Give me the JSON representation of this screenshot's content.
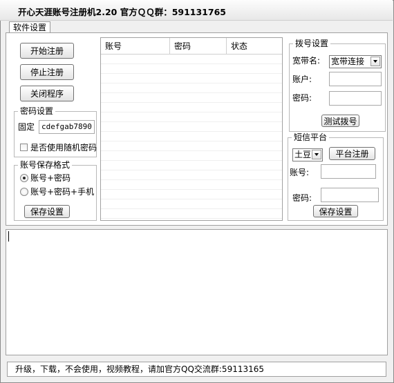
{
  "window": {
    "title": "开心天涯账号注册机2.20    官方ＱＱ群：591131765"
  },
  "tabs": [
    {
      "label": "软件设置"
    }
  ],
  "controls": {
    "start_label": "开始注册",
    "stop_label": "停止注册",
    "close_label": "关闭程序"
  },
  "password_settings": {
    "legend": "密码设置",
    "fixed_label": "固定",
    "fixed_value": "cdefgab7890",
    "random_label": "是否使用随机密码",
    "random_checked": false
  },
  "save_format": {
    "legend": "账号保存格式",
    "options": [
      {
        "label": "账号+密码",
        "checked": true
      },
      {
        "label": "账号+密码+手机",
        "checked": false
      }
    ],
    "save_label": "保存设置"
  },
  "accounts_table": {
    "columns": [
      "账号",
      "密码",
      "状态"
    ],
    "rows": []
  },
  "dial_settings": {
    "legend": "拨号设置",
    "broadband_label": "宽带名:",
    "broadband_value": "宽带连接",
    "account_label": "账户:",
    "account_value": "",
    "password_label": "密码:",
    "password_value": "",
    "test_label": "测试拨号"
  },
  "sms_platform": {
    "legend": "短信平台",
    "platform_value": "土豆",
    "register_label": "平台注册",
    "account_label": "账号:",
    "account_value": "",
    "password_label": "密码:",
    "password_value": "",
    "save_label": "保存设置"
  },
  "log": {
    "text": ""
  },
  "status": {
    "text": "升级，下载，不会使用，视频教程，请加官方QQ交流群:59113165"
  }
}
